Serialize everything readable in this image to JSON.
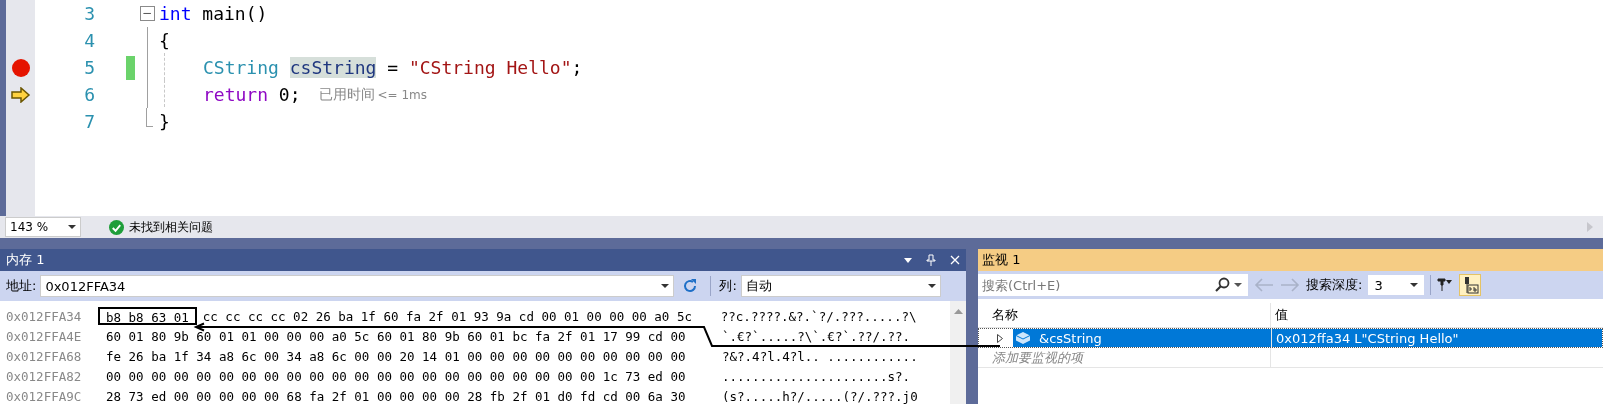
{
  "editor": {
    "lines": [
      {
        "number": "3",
        "fold": "−",
        "tokens": [
          {
            "kind": "keyword",
            "text": "int"
          },
          {
            "kind": "plain",
            "text": " main()"
          }
        ]
      },
      {
        "number": "4",
        "tokens": [
          {
            "kind": "plain",
            "text": "{"
          }
        ]
      },
      {
        "number": "5",
        "breakpoint": true,
        "changed": true,
        "tokens": [
          {
            "kind": "type",
            "text": "CString "
          },
          {
            "kind": "highlight",
            "text": "csString"
          },
          {
            "kind": "plain",
            "text": " = "
          },
          {
            "kind": "string",
            "text": "\"CString Hello\""
          },
          {
            "kind": "plain",
            "text": ";"
          }
        ]
      },
      {
        "number": "6",
        "current": true,
        "tokens": [
          {
            "kind": "control",
            "text": "return"
          },
          {
            "kind": "plain",
            "text": " 0;"
          }
        ],
        "hint": "已用时间",
        "hint_value": "<= 1ms"
      },
      {
        "number": "7",
        "tokens": [
          {
            "kind": "plain",
            "text": "}"
          }
        ]
      }
    ]
  },
  "status_bar": {
    "zoom": "143 %",
    "message": "未找到相关问题"
  },
  "memory": {
    "title": "内存 1",
    "address_label": "地址:",
    "address": "0x012FFA34",
    "columns_label": "列:",
    "columns": "自动",
    "rows": [
      {
        "address": "0x012FFA34",
        "framed": "b8 b8 63 01",
        "bytes": "cc cc cc cc 02 26 ba 1f 60 fa 2f 01 93 9a cd 00 01 00 00 00 a0 5c",
        "ascii": "??c.????.&?.`?/.???.....?\\"
      },
      {
        "address": "0x012FFA4E",
        "bytes": "60 01 80 9b 60 01 01 00 00 00 a0 5c 60 01 80 9b 60 01 bc fa 2f 01 17 99 cd 00",
        "ascii": "`.€?`.....?\\`.€?`.??/.??."
      },
      {
        "address": "0x012FFA68",
        "bytes": "fe 26 ba 1f 34 a8 6c 00 34 a8 6c 00 00 20 14 01 00 00 00 00 00 00 00 00 00 00",
        "ascii": "?&?.4?l.4?l.. ............"
      },
      {
        "address": "0x012FFA82",
        "bytes": "00 00 00 00 00 00 00 00 00 00 00 00 00 00 00 00 00 00 00 00 00 00 1c 73 ed 00",
        "ascii": "......................s?."
      },
      {
        "address": "0x012FFA9C",
        "bytes": "28 73 ed 00 00 00 00 00 68 fa 2f 01 00 00 00 00 28 fb 2f 01 d0 fd cd 00 6a 30",
        "ascii": "(s?.....h?/.....(?/.???.j0"
      }
    ]
  },
  "watch": {
    "title": "监视 1",
    "search_placeholder": "搜索(Ctrl+E)",
    "depth_label": "搜索深度:",
    "depth": "3",
    "columns": [
      "名称",
      "值"
    ],
    "rows": [
      {
        "name": "&csString",
        "value": "0x012ffa34 L\"CString Hello\"",
        "selected": true
      }
    ],
    "add_hint": "添加要监视的项"
  }
}
